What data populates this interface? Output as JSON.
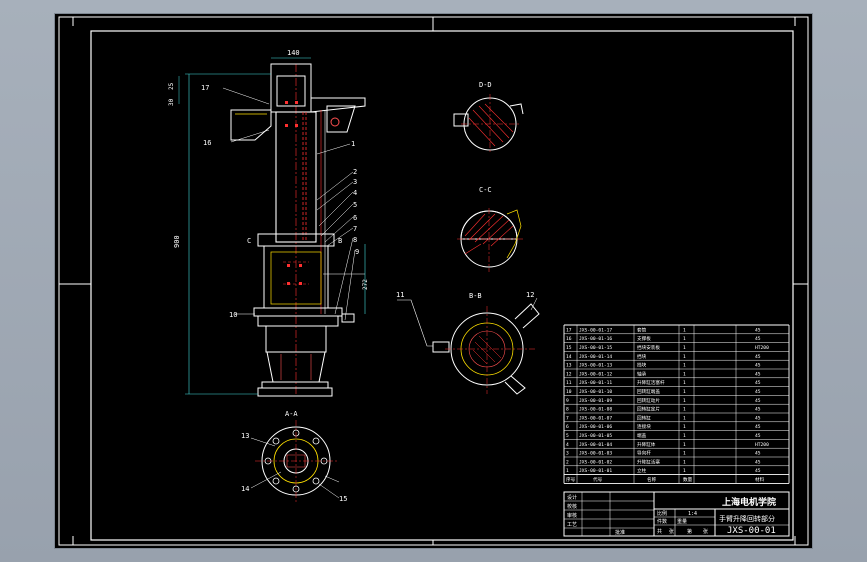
{
  "balloons": [
    "17",
    "16",
    "1",
    "2",
    "3",
    "4",
    "5",
    "6",
    "7",
    "8",
    "9",
    "10",
    "11",
    "12",
    "13",
    "14",
    "15"
  ],
  "dims": {
    "top_width": "140",
    "total_height": "900",
    "left_small": [
      "25",
      "30"
    ],
    "right_mid": "272"
  },
  "section_labels": {
    "d_section": "D-D",
    "c_section": "C-C",
    "b_section": "B-B",
    "a_section": "A-A",
    "cut_c": "C",
    "cut_b": "B"
  },
  "title_block": {
    "school": "上海电机学院",
    "drawing_title": "手臂升降回转部分",
    "drawing_no": "JXS-00-01",
    "scale": "1:4",
    "row_labels": [
      "设计",
      "校核",
      "审核",
      "工艺",
      "批准"
    ],
    "col_labels": [
      "比例",
      "件数",
      "重量",
      "共",
      "张",
      "第",
      "张"
    ]
  },
  "bom": {
    "header": [
      "序号",
      "代号",
      "名称",
      "数量",
      "材料"
    ],
    "rows": [
      [
        "17",
        "JXS-00-01-17",
        "套筒",
        "1",
        "45"
      ],
      [
        "16",
        "JXS-00-01-16",
        "支撑板",
        "1",
        "45"
      ],
      [
        "15",
        "JXS-00-01-15",
        "挡块安装板",
        "1",
        "HT200"
      ],
      [
        "14",
        "JXS-00-01-14",
        "挡块",
        "1",
        "45"
      ],
      [
        "13",
        "JXS-00-01-13",
        "挡块",
        "1",
        "45"
      ],
      [
        "12",
        "JXS-00-01-12",
        "轴承",
        "1",
        "45"
      ],
      [
        "11",
        "JXS-00-01-11",
        "升降缸活塞杆",
        "1",
        "45"
      ],
      [
        "10",
        "JXS-00-01-10",
        "回转缸端盖",
        "1",
        "45"
      ],
      [
        "9",
        "JXS-00-01-09",
        "回转缸动片",
        "1",
        "45"
      ],
      [
        "8",
        "JXS-00-01-08",
        "回转缸定片",
        "1",
        "45"
      ],
      [
        "7",
        "JXS-00-01-07",
        "回转缸",
        "1",
        "45"
      ],
      [
        "6",
        "JXS-00-01-06",
        "连接块",
        "1",
        "45"
      ],
      [
        "5",
        "JXS-00-01-05",
        "端盖",
        "1",
        "45"
      ],
      [
        "4",
        "JXS-00-01-04",
        "升降缸体",
        "1",
        "HT200"
      ],
      [
        "3",
        "JXS-00-01-03",
        "导向杆",
        "1",
        "45"
      ],
      [
        "2",
        "JXS-00-01-02",
        "升降缸活塞",
        "1",
        "45"
      ],
      [
        "1",
        "JXS-00-01-01",
        "立柱",
        "1",
        "45"
      ]
    ]
  }
}
